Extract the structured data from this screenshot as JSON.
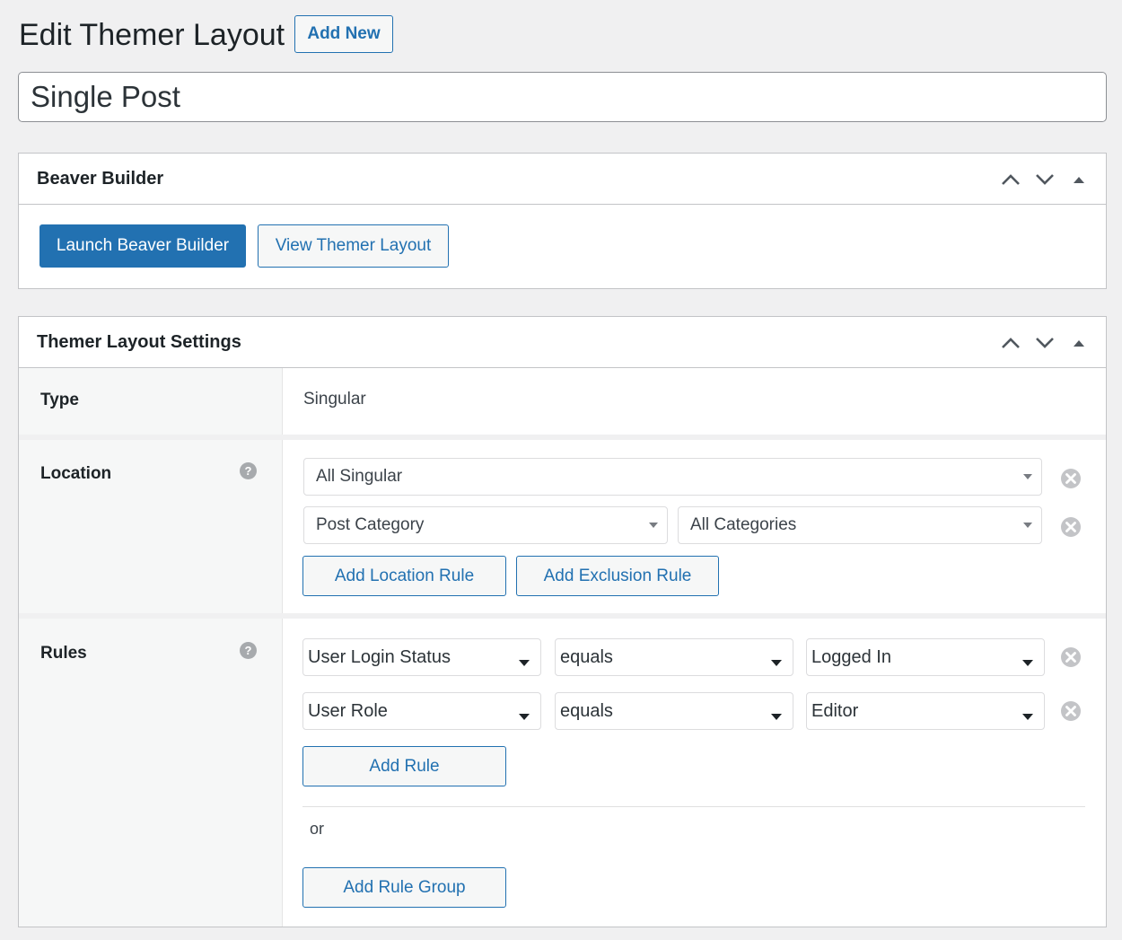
{
  "header": {
    "title": "Edit Themer Layout",
    "add_new_label": "Add New"
  },
  "post_title": {
    "value": "Single Post"
  },
  "beaver_box": {
    "title": "Beaver Builder",
    "launch_label": "Launch Beaver Builder",
    "view_label": "View Themer Layout"
  },
  "settings_box": {
    "title": "Themer Layout Settings",
    "type": {
      "label": "Type",
      "value": "Singular"
    },
    "location": {
      "label": "Location",
      "help": "?",
      "rule1": "All Singular",
      "rule2_a": "Post Category",
      "rule2_b": "All Categories",
      "add_location_label": "Add Location Rule",
      "add_exclusion_label": "Add Exclusion Rule"
    },
    "rules": {
      "label": "Rules",
      "help": "?",
      "rows": [
        {
          "subject": "User Login Status",
          "operator": "equals",
          "value": "Logged In"
        },
        {
          "subject": "User Role",
          "operator": "equals",
          "value": "Editor"
        }
      ],
      "add_rule_label": "Add Rule",
      "or_text": "or",
      "add_group_label": "Add Rule Group"
    }
  },
  "icons": {
    "move_up": "chevron-up-icon",
    "move_down": "chevron-down-icon",
    "toggle": "triangle-up-icon",
    "remove": "close-circle-icon",
    "help": "help-icon"
  },
  "colors": {
    "primary": "#2271b1",
    "background": "#f0f0f1",
    "icon_gray": "#a7aaad"
  }
}
